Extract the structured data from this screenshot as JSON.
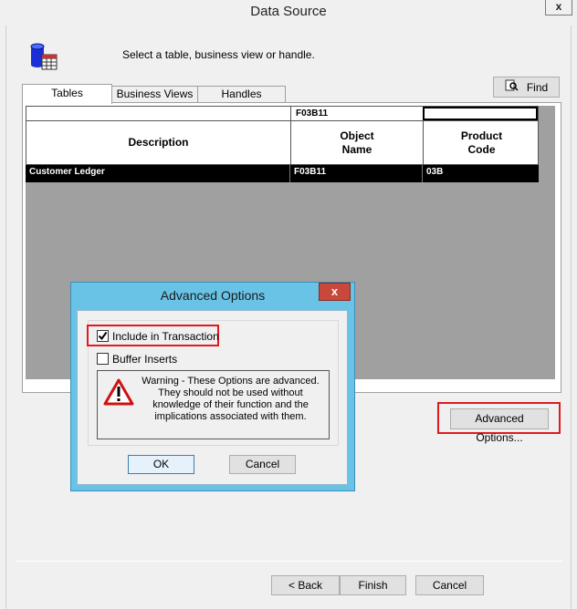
{
  "window": {
    "title": "Data Source",
    "close_glyph": "x"
  },
  "header": {
    "prompt": "Select a table, business view or handle."
  },
  "toolbar": {
    "find_label": "Find"
  },
  "tabs": [
    {
      "label": "Tables"
    },
    {
      "label": "Business Views"
    },
    {
      "label": "Handles"
    }
  ],
  "grid": {
    "filter": {
      "description": "",
      "object_name": "F03B11",
      "product_code": ""
    },
    "columns": [
      "Description",
      "Object\nName",
      "Product\nCode"
    ],
    "rows": [
      {
        "description": "Customer Ledger",
        "object_name": "F03B11",
        "product_code": "03B"
      }
    ]
  },
  "buttons": {
    "advanced_options": "Advanced Options...",
    "back": "< Back",
    "finish": "Finish",
    "cancel": "Cancel"
  },
  "modal": {
    "title": "Advanced Options",
    "close_glyph": "x",
    "include_in_transaction": {
      "label": "Include in Transaction",
      "checked": true
    },
    "buffer_inserts": {
      "label": "Buffer Inserts",
      "checked": false
    },
    "warning": "Warning - These Options are advanced. They should not be used without knowledge of their function and the implications associated with them.",
    "ok_label": "OK",
    "cancel_label": "Cancel"
  },
  "colors": {
    "highlight": "#e0191f",
    "modal_frame": "#69c3e6",
    "modal_close": "#c9483c"
  }
}
